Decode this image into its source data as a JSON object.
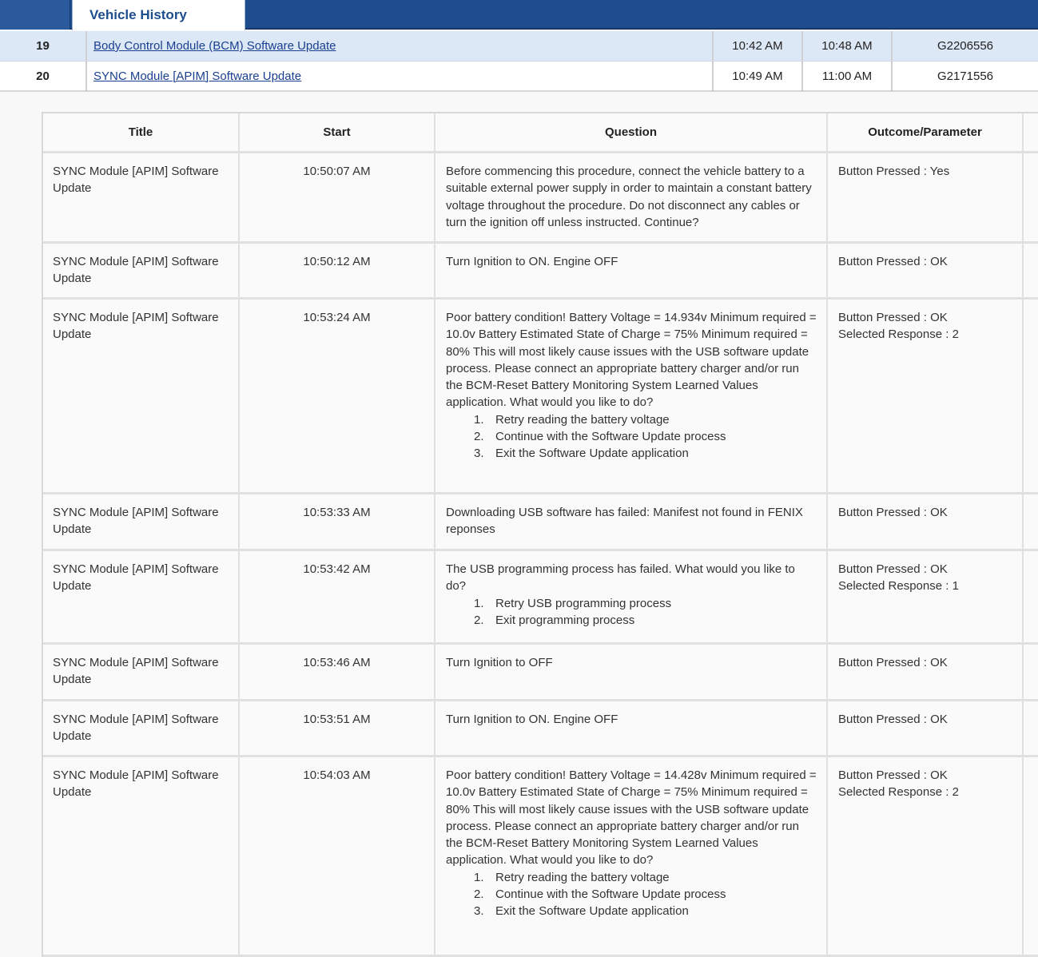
{
  "tab": {
    "label": "Vehicle History"
  },
  "history": [
    {
      "num": "19",
      "title": "Body Control Module (BCM) Software Update",
      "start": "10:42 AM",
      "end": "10:48 AM",
      "id": "G2206556"
    },
    {
      "num": "20",
      "title": "SYNC Module [APIM] Software Update",
      "start": "10:49 AM",
      "end": "11:00 AM",
      "id": "G2171556"
    }
  ],
  "detail": {
    "headers": {
      "title": "Title",
      "start": "Start",
      "question": "Question",
      "outcome": "Outcome/Parameter"
    },
    "rows": [
      {
        "title": "SYNC Module [APIM] Software Update",
        "start": "10:50:07 AM",
        "question": "Before commencing this procedure, connect the vehicle battery to a suitable external power supply in order to maintain a constant battery voltage throughout the procedure. Do not disconnect any cables or turn the ignition off unless instructed. Continue?",
        "options": [],
        "outcome": [
          "Button Pressed : Yes"
        ]
      },
      {
        "title": "SYNC Module [APIM] Software Update",
        "start": "10:50:12 AM",
        "question": "Turn Ignition to ON. Engine OFF",
        "options": [],
        "outcome": [
          "Button Pressed : OK"
        ]
      },
      {
        "title": "SYNC Module [APIM] Software Update",
        "start": "10:53:24 AM",
        "question": "Poor battery condition! Battery Voltage = 14.934v Minimum required = 10.0v Battery Estimated State of Charge = 75% Minimum required = 80% This will most likely cause issues with the USB software update process. Please connect an appropriate battery charger and/or run the BCM-Reset Battery Monitoring System Learned Values application. What would you like to do?",
        "options": [
          "Retry reading the battery voltage",
          "Continue with the Software Update process",
          "Exit the Software Update application"
        ],
        "outcome": [
          "Button Pressed : OK",
          "Selected Response : 2"
        ]
      },
      {
        "title": "SYNC Module [APIM] Software Update",
        "start": "10:53:33 AM",
        "question": "Downloading USB software has failed: Manifest not found in FENIX reponses",
        "options": [],
        "outcome": [
          "Button Pressed : OK"
        ]
      },
      {
        "title": "SYNC Module [APIM] Software Update",
        "start": "10:53:42 AM",
        "question": "The USB programming process has failed. What would you like to do?",
        "options": [
          "Retry USB programming process",
          "Exit programming process"
        ],
        "outcome": [
          "Button Pressed : OK",
          "Selected Response : 1"
        ]
      },
      {
        "title": "SYNC Module [APIM] Software Update",
        "start": "10:53:46 AM",
        "question": "Turn Ignition to OFF",
        "options": [],
        "outcome": [
          "Button Pressed : OK"
        ]
      },
      {
        "title": "SYNC Module [APIM] Software Update",
        "start": "10:53:51 AM",
        "question": "Turn Ignition to ON. Engine OFF",
        "options": [],
        "outcome": [
          "Button Pressed : OK"
        ]
      },
      {
        "title": "SYNC Module [APIM] Software Update",
        "start": "10:54:03 AM",
        "question": "Poor battery condition! Battery Voltage = 14.428v Minimum required = 10.0v Battery Estimated State of Charge = 75% Minimum required = 80% This will most likely cause issues with the USB software update process. Please connect an appropriate battery charger and/or run the BCM-Reset Battery Monitoring System Learned Values application. What would you like to do?",
        "options": [
          "Retry reading the battery voltage",
          "Continue with the Software Update process",
          "Exit the Software Update application"
        ],
        "outcome": [
          "Button Pressed : OK",
          "Selected Response : 2"
        ]
      }
    ]
  }
}
